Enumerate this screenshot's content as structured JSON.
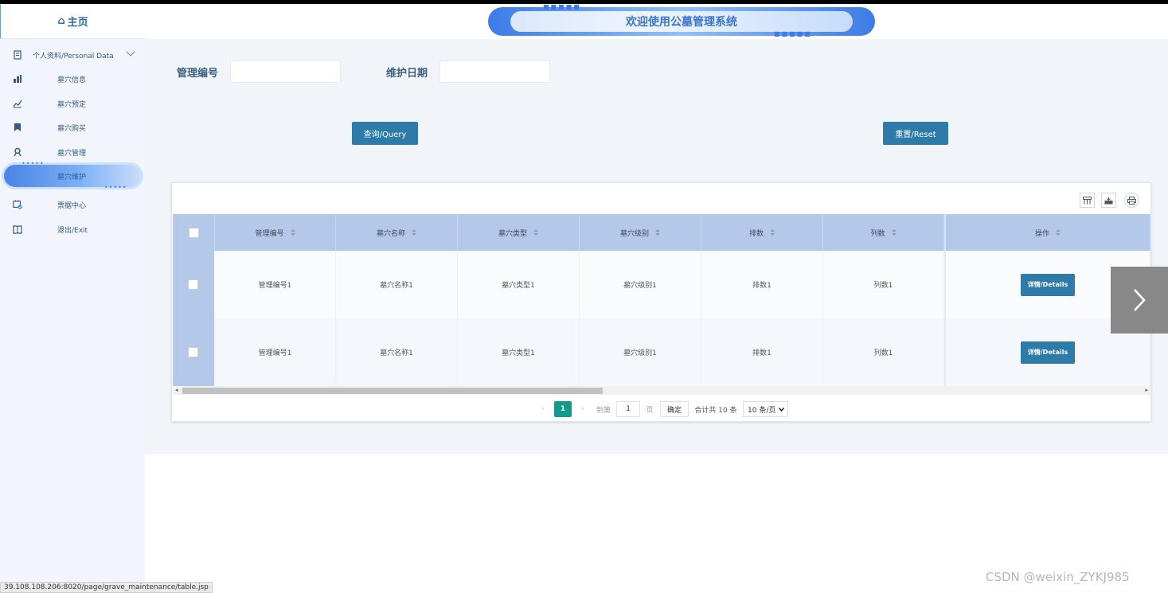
{
  "sidebar": {
    "home": "主页",
    "items": [
      {
        "label": "个人资料/Personal Data",
        "icon": "document-icon"
      },
      {
        "label": "墓穴信息",
        "icon": "bar-chart-icon"
      },
      {
        "label": "墓穴预定",
        "icon": "chart-icon"
      },
      {
        "label": "墓穴购买",
        "icon": "bookmark-icon"
      },
      {
        "label": "墓穴管理",
        "icon": "user-badge-icon"
      },
      {
        "label": "墓穴维护",
        "icon": "active-item"
      },
      {
        "label": "票据中心",
        "icon": "calendar-check-icon"
      },
      {
        "label": "退出/Exit",
        "icon": "book-icon"
      }
    ]
  },
  "header": {
    "banner": "欢迎使用公墓管理系统"
  },
  "filters": {
    "manage_no_label": "管理编号",
    "maintain_date_label": "维护日期"
  },
  "buttons": {
    "query": "查询/Query",
    "reset": "重置/Reset"
  },
  "table": {
    "columns": [
      "管理编号",
      "墓穴名称",
      "墓穴类型",
      "墓穴级别",
      "排数",
      "列数",
      "操作"
    ],
    "rows": [
      {
        "no": "管理编号1",
        "name": "墓穴名称1",
        "type": "墓穴类型1",
        "level": "墓穴级别1",
        "row": "排数1",
        "col": "列数1",
        "action": "详情/Details"
      },
      {
        "no": "管理编号1",
        "name": "墓穴名称1",
        "type": "墓穴类型1",
        "level": "墓穴级别1",
        "row": "排数1",
        "col": "列数1",
        "action": "详情/Details"
      }
    ]
  },
  "pager": {
    "current": "1",
    "goto_label": "到第",
    "goto_value": "1",
    "page_unit": "页",
    "confirm": "确定",
    "total": "合计共 10 条",
    "page_size": "10 条/页"
  },
  "status_url": "39.108.108.206:8020/page/grave_maintenance/table.jsp",
  "watermark": "CSDN @weixin_ZYKJ985",
  "colors": {
    "accent": "#2e7aa8",
    "header_row": "#b4c9e9",
    "pager_current": "#16998a"
  }
}
